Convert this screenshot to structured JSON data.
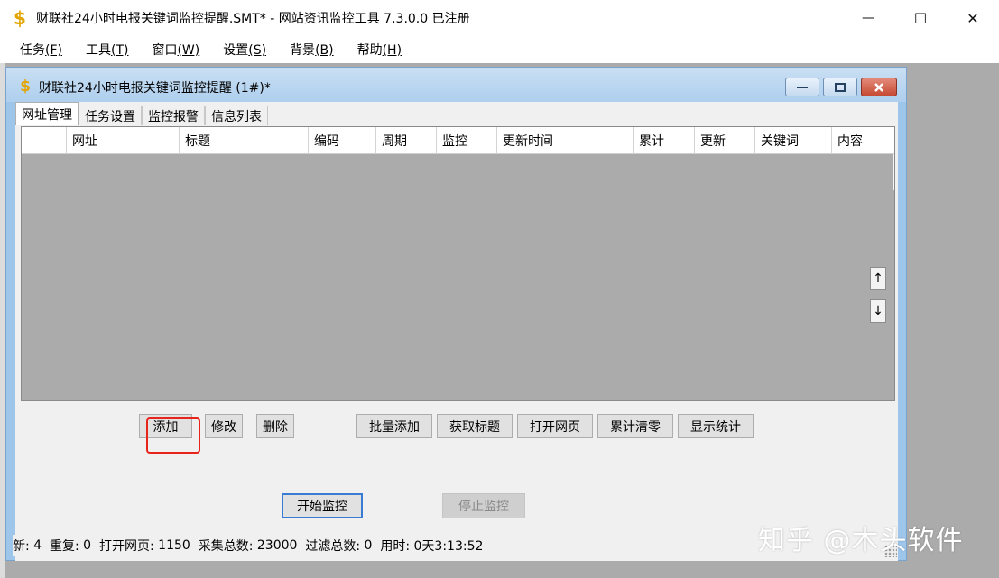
{
  "window": {
    "title": "财联社24小时电报关键词监控提醒.SMT* - 网站资讯监控工具 7.3.0.0  已注册",
    "app_icon": "dollar-icon",
    "controls": {
      "minimize": "—",
      "maximize": "☐",
      "close": "✕"
    }
  },
  "menubar": {
    "items": [
      {
        "label": "任务",
        "key": "(F)"
      },
      {
        "label": "工具",
        "key": "(T)"
      },
      {
        "label": "窗口",
        "key": "(W)"
      },
      {
        "label": "设置",
        "key": "(S)"
      },
      {
        "label": "背景",
        "key": "(B)"
      },
      {
        "label": "帮助",
        "key": "(H)"
      }
    ]
  },
  "child_window": {
    "title": "财联社24小时电报关键词监控提醒 (1#)*",
    "tabs": [
      {
        "label": "网址管理",
        "active": true
      },
      {
        "label": "任务设置",
        "active": false
      },
      {
        "label": "监控报警",
        "active": false
      },
      {
        "label": "信息列表",
        "active": false
      }
    ],
    "columns": [
      "",
      "网址",
      "标题",
      "编码",
      "周期",
      "监控",
      "更新时间",
      "累计",
      "更新",
      "关键词",
      "内容"
    ],
    "arrows": {
      "up": "↑",
      "down": "↓"
    },
    "buttons": {
      "add": "添加",
      "edit": "修改",
      "delete": "删除",
      "batch_add": "批量添加",
      "get_title": "获取标题",
      "open_page": "打开网页",
      "reset_total": "累计清零",
      "show_stats": "显示统计"
    },
    "start_monitor": "开始监控",
    "stop_monitor": "停止监控"
  },
  "status": {
    "new_label": "新:",
    "new_value": "4",
    "repeat_label": "重复:",
    "repeat_value": "0",
    "opened_label": "打开网页:",
    "opened_value": "1150",
    "collected_label": "采集总数:",
    "collected_value": "23000",
    "filtered_label": "过滤总数:",
    "filtered_value": "0",
    "elapsed_label": "用时:",
    "elapsed_value": "0天3:13:52"
  },
  "watermark": "知乎 @木头软件",
  "colors": {
    "mdi_background": "#ababab",
    "child_titlebar": "#aecfee",
    "highlight": "#e8231b",
    "default_button_border": "#3a7bd5"
  }
}
